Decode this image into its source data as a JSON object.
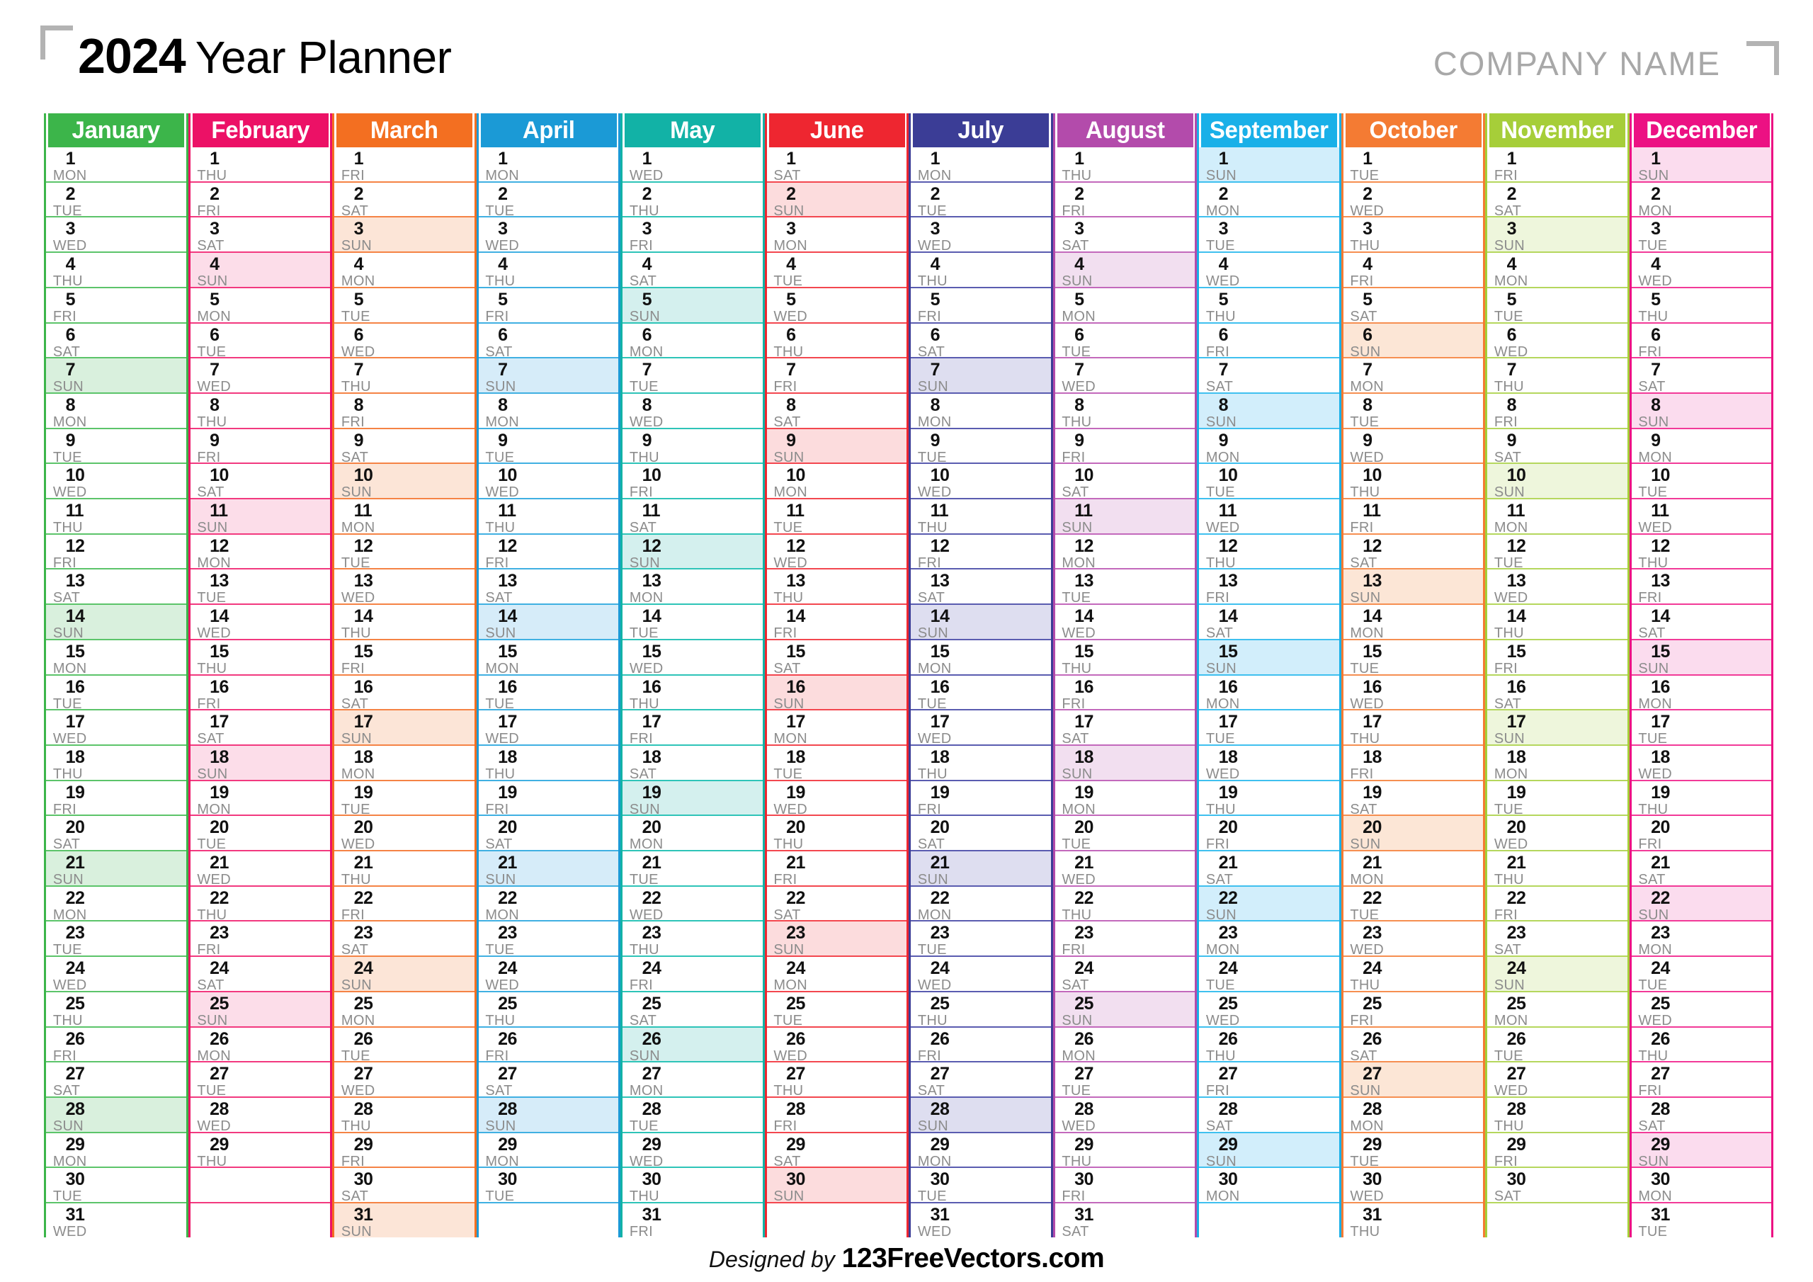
{
  "header": {
    "year": "2024",
    "title_label": "Year Planner",
    "company_name": "COMPANY NAME",
    "corner_bracket_color": "#b3b3b3"
  },
  "footer": {
    "designed_by": "Designed by",
    "brand": "123FreeVectors.com"
  },
  "weekday_abbrevs": [
    "MON",
    "TUE",
    "WED",
    "THU",
    "FRI",
    "SAT",
    "SUN"
  ],
  "highlight_weekday": "SUN",
  "months": [
    {
      "name": "January",
      "color": "#3cb54a",
      "tint": "#d9f0dd",
      "border": "#5cc46a",
      "days": 31,
      "start_weekday": "MON",
      "day_abbrevs": [
        "MON",
        "TUE",
        "WED",
        "THU",
        "FRI",
        "SAT",
        "SUN",
        "MON",
        "TUE",
        "WED",
        "THU",
        "FRI",
        "SAT",
        "SUN",
        "MON",
        "TUE",
        "WED",
        "THU",
        "FRI",
        "SAT",
        "SUN",
        "MON",
        "TUE",
        "WED",
        "THU",
        "FRI",
        "SAT",
        "SUN",
        "MON",
        "TUE",
        "WED"
      ]
    },
    {
      "name": "February",
      "color": "#ec1166",
      "tint": "#fcdde9",
      "border": "#f2397f",
      "days": 29,
      "start_weekday": "THU",
      "day_abbrevs": [
        "THU",
        "FRI",
        "SAT",
        "SUN",
        "MON",
        "TUE",
        "WED",
        "THU",
        "FRI",
        "SAT",
        "SUN",
        "MON",
        "TUE",
        "WED",
        "THU",
        "FRI",
        "SAT",
        "SUN",
        "MON",
        "TUE",
        "WED",
        "THU",
        "FRI",
        "SAT",
        "SUN",
        "MON",
        "TUE",
        "WED",
        "THU"
      ]
    },
    {
      "name": "March",
      "color": "#f36f21",
      "tint": "#fce5d7",
      "border": "#f58345",
      "days": 31,
      "start_weekday": "FRI",
      "day_abbrevs": [
        "FRI",
        "SAT",
        "SUN",
        "MON",
        "TUE",
        "WED",
        "THU",
        "FRI",
        "SAT",
        "SUN",
        "MON",
        "TUE",
        "WED",
        "THU",
        "FRI",
        "SAT",
        "SUN",
        "MON",
        "TUE",
        "WED",
        "THU",
        "FRI",
        "SAT",
        "SUN",
        "MON",
        "TUE",
        "WED",
        "THU",
        "FRI",
        "SAT",
        "SUN"
      ]
    },
    {
      "name": "April",
      "color": "#1b9ad6",
      "tint": "#d6ecf9",
      "border": "#40b0e2",
      "days": 30,
      "start_weekday": "MON",
      "day_abbrevs": [
        "MON",
        "TUE",
        "WED",
        "THU",
        "FRI",
        "SAT",
        "SUN",
        "MON",
        "TUE",
        "WED",
        "THU",
        "FRI",
        "SAT",
        "SUN",
        "MON",
        "TUE",
        "WED",
        "THU",
        "FRI",
        "SAT",
        "SUN",
        "MON",
        "TUE",
        "WED",
        "THU",
        "FRI",
        "SAT",
        "SUN",
        "MON",
        "TUE"
      ]
    },
    {
      "name": "May",
      "color": "#12b2a6",
      "tint": "#d4f0ee",
      "border": "#2ec4b8",
      "days": 31,
      "start_weekday": "WED",
      "day_abbrevs": [
        "WED",
        "THU",
        "FRI",
        "SAT",
        "SUN",
        "MON",
        "TUE",
        "WED",
        "THU",
        "FRI",
        "SAT",
        "SUN",
        "MON",
        "TUE",
        "WED",
        "THU",
        "FRI",
        "SAT",
        "SUN",
        "MON",
        "TUE",
        "WED",
        "THU",
        "FRI",
        "SAT",
        "SUN",
        "MON",
        "TUE",
        "WED",
        "THU",
        "FRI"
      ]
    },
    {
      "name": "June",
      "color": "#ee2630",
      "tint": "#fcdcdd",
      "border": "#f3474f",
      "days": 30,
      "start_weekday": "SAT",
      "day_abbrevs": [
        "SAT",
        "SUN",
        "MON",
        "TUE",
        "WED",
        "THU",
        "FRI",
        "SAT",
        "SUN",
        "MON",
        "TUE",
        "WED",
        "THU",
        "FRI",
        "SAT",
        "SUN",
        "MON",
        "TUE",
        "WED",
        "THU",
        "FRI",
        "SAT",
        "SUN",
        "MON",
        "TUE",
        "WED",
        "THU",
        "FRI",
        "SAT",
        "SUN"
      ]
    },
    {
      "name": "July",
      "color": "#3b3d96",
      "tint": "#dedef0",
      "border": "#5a5cb0",
      "days": 31,
      "start_weekday": "MON",
      "day_abbrevs": [
        "MON",
        "TUE",
        "WED",
        "THU",
        "FRI",
        "SAT",
        "SUN",
        "MON",
        "TUE",
        "WED",
        "THU",
        "FRI",
        "SAT",
        "SUN",
        "MON",
        "TUE",
        "WED",
        "THU",
        "FRI",
        "SAT",
        "SUN",
        "MON",
        "TUE",
        "WED",
        "THU",
        "FRI",
        "SAT",
        "SUN",
        "MON",
        "TUE",
        "WED"
      ]
    },
    {
      "name": "August",
      "color": "#b34bab",
      "tint": "#f2dff0",
      "border": "#c369bc",
      "days": 31,
      "start_weekday": "THU",
      "day_abbrevs": [
        "THU",
        "FRI",
        "SAT",
        "SUN",
        "MON",
        "TUE",
        "WED",
        "THU",
        "FRI",
        "SAT",
        "SUN",
        "MON",
        "TUE",
        "WED",
        "THU",
        "FRI",
        "SAT",
        "SUN",
        "MON",
        "TUE",
        "WED",
        "THU",
        "FRI",
        "SAT",
        "SUN",
        "MON",
        "TUE",
        "WED",
        "THU",
        "FRI",
        "SAT"
      ]
    },
    {
      "name": "September",
      "color": "#19b0e8",
      "tint": "#d2eefb",
      "border": "#3fc0ef",
      "days": 30,
      "start_weekday": "SUN",
      "day_abbrevs": [
        "SUN",
        "MON",
        "TUE",
        "WED",
        "THU",
        "FRI",
        "SAT",
        "SUN",
        "MON",
        "TUE",
        "WED",
        "THU",
        "FRI",
        "SAT",
        "SUN",
        "MON",
        "TUE",
        "WED",
        "THU",
        "FRI",
        "SAT",
        "SUN",
        "MON",
        "TUE",
        "WED",
        "THU",
        "FRI",
        "SAT",
        "SUN",
        "MON"
      ]
    },
    {
      "name": "October",
      "color": "#f47b33",
      "tint": "#fce6d6",
      "border": "#f68f51",
      "days": 31,
      "start_weekday": "TUE",
      "day_abbrevs": [
        "TUE",
        "WED",
        "THU",
        "FRI",
        "SAT",
        "SUN",
        "MON",
        "TUE",
        "WED",
        "THU",
        "FRI",
        "SAT",
        "SUN",
        "MON",
        "TUE",
        "WED",
        "THU",
        "FRI",
        "SAT",
        "SUN",
        "MON",
        "TUE",
        "WED",
        "THU",
        "FRI",
        "SAT",
        "SUN",
        "MON",
        "TUE",
        "WED",
        "THU"
      ]
    },
    {
      "name": "November",
      "color": "#a6ce39",
      "tint": "#eef6dc",
      "border": "#b5d75d",
      "days": 30,
      "start_weekday": "FRI",
      "day_abbrevs": [
        "FRI",
        "SAT",
        "SUN",
        "MON",
        "TUE",
        "WED",
        "THU",
        "FRI",
        "SAT",
        "SUN",
        "MON",
        "TUE",
        "WED",
        "THU",
        "FRI",
        "SAT",
        "SUN",
        "MON",
        "TUE",
        "WED",
        "THU",
        "FRI",
        "SAT",
        "SUN",
        "MON",
        "TUE",
        "WED",
        "THU",
        "FRI",
        "SAT"
      ]
    },
    {
      "name": "December",
      "color": "#ec1183",
      "tint": "#fbdcee",
      "border": "#f23a98",
      "days": 31,
      "start_weekday": "SUN",
      "day_abbrevs": [
        "SUN",
        "MON",
        "TUE",
        "WED",
        "THU",
        "FRI",
        "SAT",
        "SUN",
        "MON",
        "TUE",
        "WED",
        "THU",
        "FRI",
        "SAT",
        "SUN",
        "MON",
        "TUE",
        "WED",
        "THU",
        "FRI",
        "SAT",
        "SUN",
        "MON",
        "TUE",
        "WED",
        "THU",
        "FRI",
        "SAT",
        "SUN",
        "MON",
        "TUE"
      ]
    }
  ],
  "grid": {
    "rows": 31,
    "columns": 12
  }
}
